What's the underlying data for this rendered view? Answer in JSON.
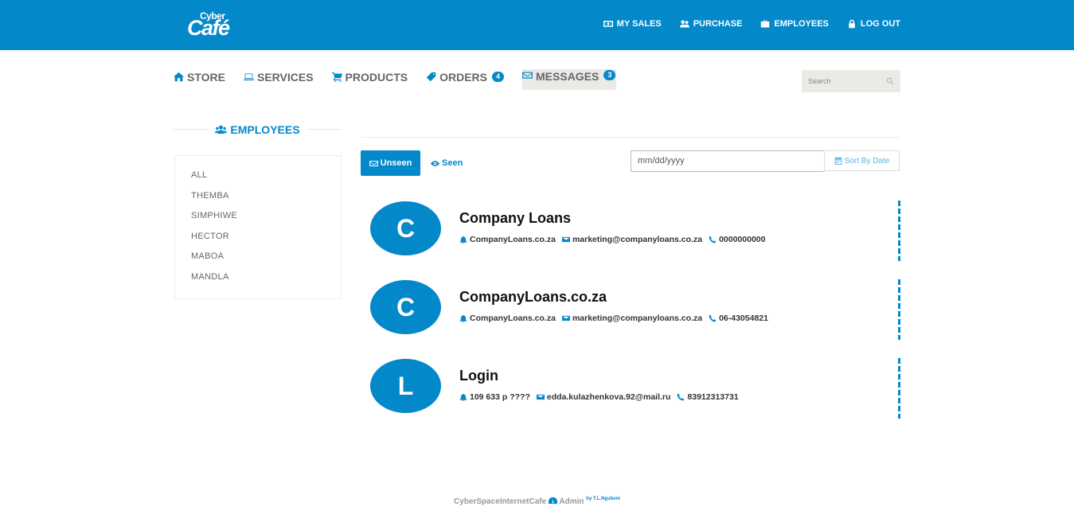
{
  "brand": {
    "logo_small": "Cyber",
    "logo_big": "Café"
  },
  "topnav": [
    {
      "label": "MY SALES",
      "icon": "money-icon"
    },
    {
      "label": "PURCHASE",
      "icon": "users-icon"
    },
    {
      "label": "EMPLOYEES",
      "icon": "briefcase-icon"
    },
    {
      "label": "LOG OUT",
      "icon": "lock-icon"
    }
  ],
  "mainnav": [
    {
      "label": "STORE",
      "icon": "home-icon"
    },
    {
      "label": "SERVICES",
      "icon": "laptop-icon"
    },
    {
      "label": "PRODUCTS",
      "icon": "cart-icon"
    },
    {
      "label": "ORDERS",
      "icon": "tag-icon",
      "badge": "4"
    },
    {
      "label": "MESSAGES",
      "icon": "envelope-icon",
      "badge": "3",
      "active": true
    }
  ],
  "search": {
    "placeholder": "Search"
  },
  "sidebar": {
    "title": "EMPLOYEES",
    "items": [
      "ALL",
      "THEMBA",
      "SIMPHIWE",
      "HECTOR",
      "MABOA",
      "MANDLA"
    ]
  },
  "filters": {
    "unseen_label": "Unseen",
    "seen_label": "Seen",
    "date_placeholder": "mm/dd/yyyy",
    "sort_label": "Sort By Date"
  },
  "messages": [
    {
      "initial": "C",
      "title": "Company Loans",
      "name": "CompanyLoans.co.za",
      "email": "marketing@companyloans.co.za",
      "phone": "0000000000"
    },
    {
      "initial": "C",
      "title": "CompanyLoans.co.za",
      "name": "CompanyLoans.co.za",
      "email": "marketing@companyloans.co.za",
      "phone": "06-43054821"
    },
    {
      "initial": "L",
      "title": "Login",
      "name": "109 633 p ????",
      "email": "edda.kulazhenkova.92@mail.ru",
      "phone": "83912313731"
    }
  ],
  "footer": {
    "text": "CyberSpaceInternetCafe",
    "admin": "Admin",
    "credit": "by T.L.Ngubeni"
  },
  "colors": {
    "primary": "#0388ca",
    "nav_active_bg": "#eceae6"
  }
}
